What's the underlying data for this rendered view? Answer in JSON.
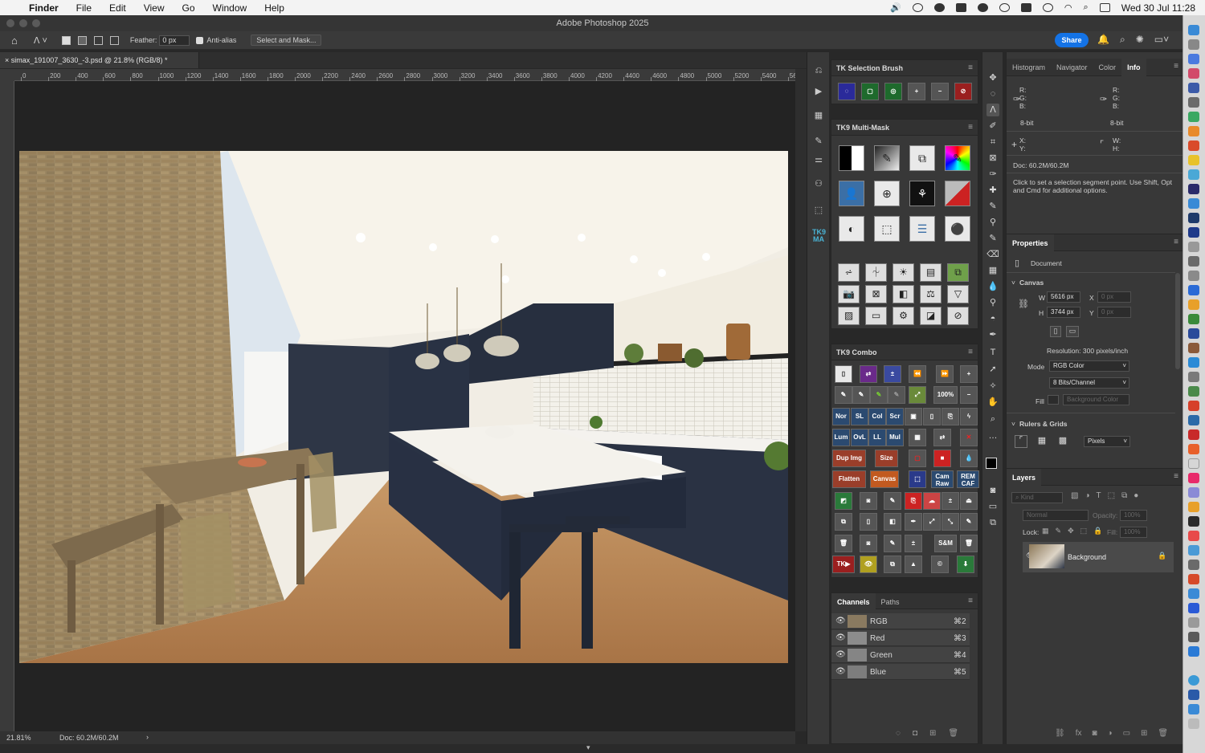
{
  "menubar": {
    "app": "Finder",
    "items": [
      "File",
      "Edit",
      "View",
      "Go",
      "Window",
      "Help"
    ],
    "clock": "Wed 30 Jul  11:28"
  },
  "window": {
    "title": "Adobe Photoshop 2025"
  },
  "options": {
    "feather_label": "Feather:",
    "feather_value": "0 px",
    "antialias_label": "Anti-alias",
    "select_mask": "Select and Mask...",
    "share": "Share"
  },
  "document": {
    "tab": "simax_191007_3630_-3.psd @ 21.8% (RGB/8) *",
    "zoom": "21.81%",
    "doc_info": "Doc: 60.2M/60.2M"
  },
  "ruler": {
    "h_ticks": [
      "0",
      "200",
      "400",
      "600",
      "800",
      "1000",
      "1200",
      "1400",
      "1600",
      "1800",
      "2000",
      "2200",
      "2400",
      "2600",
      "2800",
      "3000",
      "3200",
      "3400",
      "3600",
      "3800",
      "4000",
      "4200",
      "4400",
      "4600",
      "4800",
      "5000",
      "5200",
      "5400",
      "56"
    ]
  },
  "tk_selection": {
    "title": "TK Selection Brush"
  },
  "tk_multimask": {
    "title": "TK9 Multi-Mask"
  },
  "tk_combo": {
    "title": "TK9 Combo",
    "labels": [
      "100%",
      "Nor",
      "SL",
      "Col",
      "Scr",
      "Mul",
      "Lum",
      "OvL",
      "LL",
      "Dup Img",
      "Size",
      "Flatten",
      "Canvas",
      "Cam Raw",
      "REM CAF",
      "S&M",
      "TK"
    ]
  },
  "channels": {
    "tabs": [
      "Channels",
      "Paths"
    ],
    "rows": [
      {
        "name": "RGB",
        "key": "⌘2"
      },
      {
        "name": "Red",
        "key": "⌘3"
      },
      {
        "name": "Green",
        "key": "⌘4"
      },
      {
        "name": "Blue",
        "key": "⌘5"
      }
    ]
  },
  "info": {
    "tabs": [
      "Histogram",
      "Navigator",
      "Color",
      "Info"
    ],
    "r": "R:",
    "g": "G:",
    "b": "B:",
    "bits": "8-bit",
    "x": "X:",
    "y": "Y:",
    "w": "W:",
    "h": "H:",
    "doc": "Doc: 60.2M/60.2M",
    "hint": "Click to set a selection segment point.  Use Shift, Opt and Cmd for additional options."
  },
  "properties": {
    "title": "Properties",
    "doc_label": "Document",
    "canvas_label": "Canvas",
    "w_label": "W",
    "w_value": "5616 px",
    "h_label": "H",
    "h_value": "3744 px",
    "x_label": "X",
    "x_value": "0 px",
    "y_label": "Y",
    "y_value": "0 px",
    "resolution": "Resolution: 300 pixels/inch",
    "mode_label": "Mode",
    "mode_value": "RGB Color",
    "bits_value": "8 Bits/Channel",
    "fill_label": "Fill",
    "fill_value": "Background Color",
    "rulers_label": "Rulers & Grids",
    "units_value": "Pixels"
  },
  "layers": {
    "title": "Layers",
    "kind": "Kind",
    "blend": "Normal",
    "opacity_label": "Opacity:",
    "opacity_value": "100%",
    "lock_label": "Lock:",
    "fill_label": "Fill:",
    "fill_value": "100%",
    "layer_name": "Background"
  },
  "colors": {
    "accent": "#1473e6",
    "panel": "#383838"
  }
}
